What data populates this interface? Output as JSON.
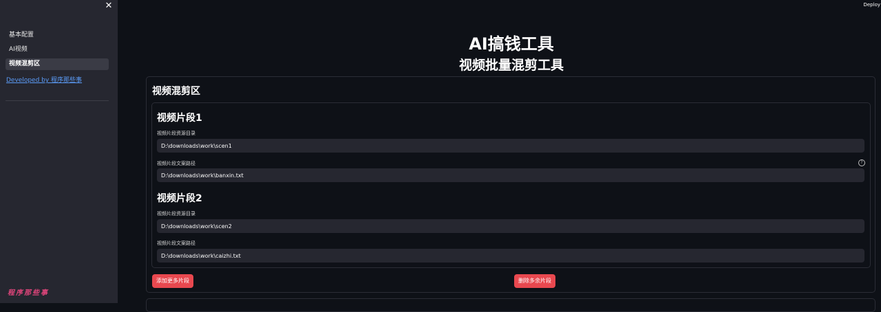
{
  "sidebar": {
    "close_icon": "close-icon",
    "nav": [
      {
        "label": "基本配置",
        "active": false
      },
      {
        "label": "AI视频",
        "active": false
      },
      {
        "label": "视频混剪区",
        "active": true
      }
    ],
    "developed_by": "Developed by 程序那些事",
    "watermark": "程序那些事"
  },
  "header": {
    "deploy_label": "Deploy"
  },
  "main": {
    "title": "AI搞钱工具",
    "subtitle": "视频批量混剪工具",
    "section_title": "视频混剪区",
    "segments": [
      {
        "title": "视频片段1",
        "dir_label": "视频片段资源目录",
        "dir_value": "D:\\downloads\\work\\scen1",
        "text_label": "视频片段文案路径",
        "text_value": "D:\\downloads\\work\\banxin.txt"
      },
      {
        "title": "视频片段2",
        "dir_label": "视频片段资源目录",
        "dir_value": "D:\\downloads\\work\\scen2",
        "text_label": "视频片段文案路径",
        "text_value": "D:\\downloads\\work\\caizhi.txt"
      }
    ],
    "add_button": "添加更多片段",
    "delete_button": "删除多余片段"
  },
  "colors": {
    "background": "#0e1117",
    "sidebar": "#262730",
    "accent": "#e8484f",
    "link": "#5b9bf6"
  }
}
